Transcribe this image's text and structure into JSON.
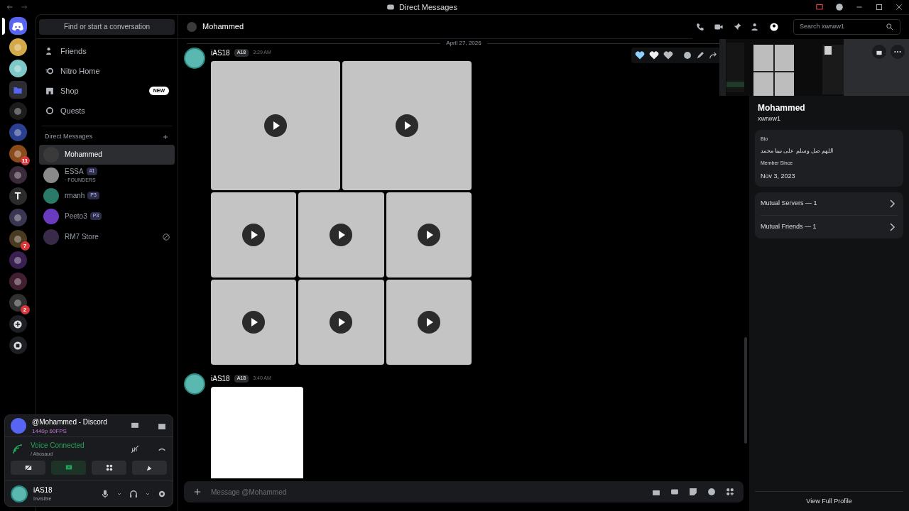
{
  "window": {
    "title": "Direct Messages"
  },
  "servers": [
    {
      "kind": "home",
      "color": "#5865f2",
      "selected": true
    },
    {
      "kind": "server",
      "color": "#d4a94a",
      "selected": false
    },
    {
      "kind": "server",
      "color": "#7fc8c8",
      "selected": false
    },
    {
      "kind": "folder",
      "color": "#2b2d31",
      "selected": false
    },
    {
      "kind": "server",
      "color": "#1c1c1c",
      "selected": false
    },
    {
      "kind": "server",
      "color": "#2a3f8f",
      "selected": false
    },
    {
      "kind": "server",
      "color": "#8a4a1a",
      "selected": false,
      "badge": "11"
    },
    {
      "kind": "server",
      "color": "#3a2a3a",
      "selected": false
    },
    {
      "kind": "letter",
      "color": "#2b2b2b",
      "selected": false,
      "letter": "T"
    },
    {
      "kind": "server",
      "color": "#3a3550",
      "selected": false
    },
    {
      "kind": "server",
      "color": "#4a3a20",
      "selected": false,
      "badge": "7"
    },
    {
      "kind": "server",
      "color": "#3a2050",
      "selected": false
    },
    {
      "kind": "server",
      "color": "#402030",
      "selected": false
    },
    {
      "kind": "server",
      "color": "#303030",
      "selected": false,
      "badge": "2"
    },
    {
      "kind": "add",
      "color": "#1e1f22",
      "selected": false
    },
    {
      "kind": "discover",
      "color": "#1e1f22",
      "selected": false
    }
  ],
  "search": {
    "placeholder": "Find or start a conversation"
  },
  "nav": [
    {
      "kind": "friends",
      "label": "Friends"
    },
    {
      "kind": "nitro",
      "label": "Nitro Home"
    },
    {
      "kind": "shop",
      "label": "Shop",
      "badge": "NEW"
    },
    {
      "kind": "quests",
      "label": "Quests"
    }
  ],
  "dm_header": "Direct Messages",
  "dms": [
    {
      "name": "Mohammed",
      "selected": true,
      "color": "#3a3a3a"
    },
    {
      "name": "ESSA",
      "tag": "#1",
      "sub": "· FOUNDERS",
      "selected": false,
      "color": "#8a8a8a"
    },
    {
      "name": "rmanh",
      "tag": "P3",
      "selected": false,
      "color": "#2a7a6a"
    },
    {
      "name": "Peeto3",
      "tag": "P3",
      "selected": false,
      "color": "#6a3ac0"
    },
    {
      "name": "RM7 Store",
      "selected": false,
      "color": "#3a2a4a",
      "blocked": true
    }
  ],
  "stream": {
    "title": "@Mohammed - Discord",
    "quality": "1440p 60FPS"
  },
  "voice": {
    "status": "Voice Connected",
    "channel": "/ Abosaud"
  },
  "user": {
    "name": "iAS18",
    "status": "Invisible"
  },
  "channel": {
    "name": "Mohammed",
    "search_placeholder": "Search xwrww1"
  },
  "date_divider": "April 27, 2026",
  "messages": [
    {
      "author": "iAS18",
      "tag": "A18",
      "time": "3:29 AM",
      "kind": "video_grid"
    },
    {
      "author": "iAS18",
      "tag": "A18",
      "time": "3:40 AM"
    }
  ],
  "composer": {
    "placeholder": "Message @Mohammed"
  },
  "profile": {
    "name": "Mohammed",
    "username": "xwrww1",
    "bio_label": "Bio",
    "bio": "اللهم صل وسلم على نبينا محمد",
    "member_label": "Member Since",
    "member_since": "Nov 3, 2023",
    "links": [
      "Mutual Servers — 1",
      "Mutual Friends — 1"
    ],
    "footer": "View Full Profile"
  }
}
